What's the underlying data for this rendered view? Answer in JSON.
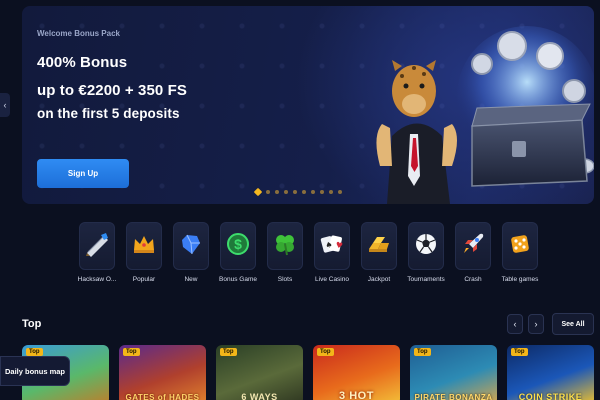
{
  "hero": {
    "subtitle": "Welcome Bonus Pack",
    "line1": "400% Bonus",
    "line2": "up to €2200 + 350 FS",
    "line3": "on the first 5 deposits",
    "cta_label": "Sign Up",
    "slide_count": 10,
    "active_slide": 1
  },
  "side_arrow": "‹",
  "categories": [
    {
      "label": "Hacksaw O...",
      "icon": "saw-icon"
    },
    {
      "label": "Popular",
      "icon": "crown-icon"
    },
    {
      "label": "New",
      "icon": "gem-icon"
    },
    {
      "label": "Bonus Game",
      "icon": "dollar-coin-icon"
    },
    {
      "label": "Slots",
      "icon": "clover-icon"
    },
    {
      "label": "Live Casino",
      "icon": "cards-icon"
    },
    {
      "label": "Jackpot",
      "icon": "gold-bars-icon"
    },
    {
      "label": "Tournaments",
      "icon": "soccer-ball-icon"
    },
    {
      "label": "Crash",
      "icon": "rocket-icon"
    },
    {
      "label": "Table games",
      "icon": "dice-icon"
    }
  ],
  "top_section": {
    "title": "Top",
    "prev": "‹",
    "next": "›",
    "see_all": "See All",
    "games": [
      {
        "badge": "Top",
        "title": ""
      },
      {
        "badge": "Top",
        "title": "GATES of HADES"
      },
      {
        "badge": "Top",
        "title": "6 WAYS"
      },
      {
        "badge": "Top",
        "title": "3 HOT"
      },
      {
        "badge": "Top",
        "title": "PIRATE BONANZA"
      },
      {
        "badge": "Top",
        "title": "COIN STRIKE"
      }
    ]
  },
  "daily_bonus": "Daily bonus map",
  "colors": {
    "background": "#0b1020",
    "accent": "#2f8cf3",
    "badge": "#f3b619",
    "active_dot": "#f5b820"
  }
}
